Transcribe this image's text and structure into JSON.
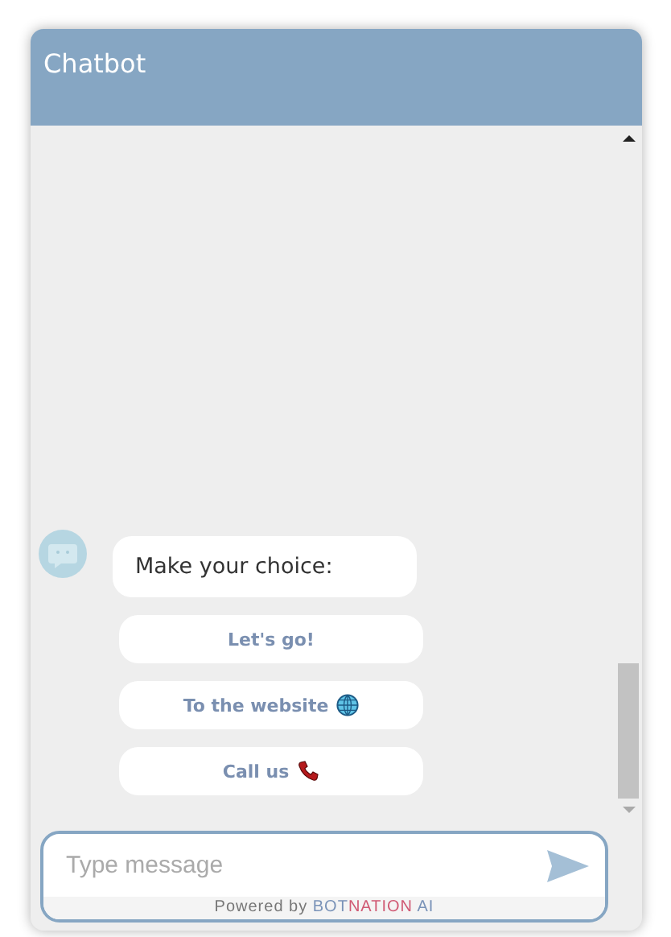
{
  "window": {
    "title": "Chatbot"
  },
  "messages": [
    {
      "text": "Make your choice:"
    }
  ],
  "choices": [
    {
      "label": "Let's go!"
    },
    {
      "label": "To the website",
      "kind": "website"
    },
    {
      "label": "Call us",
      "kind": "call"
    }
  ],
  "composer": {
    "placeholder": "Type message"
  },
  "footer": {
    "prefix": "Powered by",
    "brand": [
      {
        "text": "BOT",
        "color": "#7a93b8"
      },
      {
        "text": "NATION",
        "color": "#d05a74"
      },
      {
        "text": " AI",
        "color": "#7a93b8"
      }
    ]
  }
}
